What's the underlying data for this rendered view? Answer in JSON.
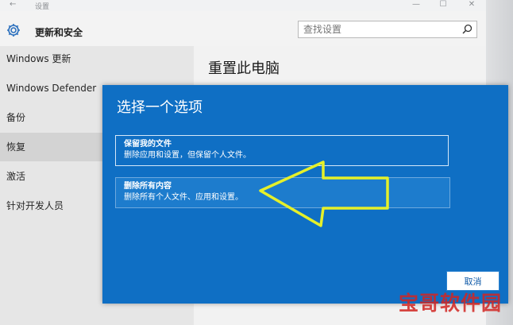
{
  "window": {
    "title": "设置",
    "back_glyph": "←",
    "min_glyph": "—",
    "max_glyph": "☐",
    "close_glyph": "✕"
  },
  "header": {
    "section_title": "更新和安全",
    "icon": "gear-icon"
  },
  "search": {
    "placeholder": "查找设置",
    "value": "",
    "icon": "search-icon"
  },
  "sidebar": {
    "items": [
      {
        "label": "Windows 更新",
        "active": false
      },
      {
        "label": "Windows Defender",
        "active": false
      },
      {
        "label": "备份",
        "active": false
      },
      {
        "label": "恢复",
        "active": true
      },
      {
        "label": "激活",
        "active": false
      },
      {
        "label": "针对开发人员",
        "active": false
      }
    ]
  },
  "main": {
    "title": "重置此电脑"
  },
  "dialog": {
    "title": "选择一个选项",
    "options": [
      {
        "title": "保留我的文件",
        "description": "删除应用和设置，但保留个人文件。"
      },
      {
        "title": "删除所有内容",
        "description": "删除所有个人文件、应用和设置。"
      }
    ],
    "cancel_label": "取消"
  },
  "annotation": {
    "arrow_color": "#e5f02a"
  },
  "watermark": {
    "text": "宝哥软件园",
    "color": "#d22622"
  },
  "colors": {
    "dialog_bg": "#0f6fc4",
    "sidebar_active": "#d3d3d3"
  }
}
